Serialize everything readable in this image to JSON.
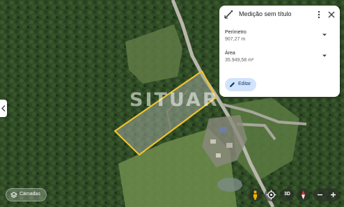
{
  "map": {
    "type": "satellite",
    "watermark": "SITUAR",
    "measured_area_color": "#f2c230"
  },
  "measurement_panel": {
    "title": "Medição sem título",
    "perimeter_label": "Perímetro",
    "perimeter_value": "907,27 m",
    "area_label": "Área",
    "area_value": "35.949,58 m²",
    "edit_label": "Editar"
  },
  "controls": {
    "layers_label": "Camadas",
    "btn_3d_label": "3D",
    "icons": [
      "pegman-icon",
      "recenter-icon",
      "compass-icon",
      "zoom-out-icon",
      "zoom-in-icon",
      "chevron-left-icon"
    ]
  },
  "colors": {
    "panel_bg": "#ffffff",
    "edit_button_bg": "#d2e3fc",
    "compass_red": "#e53935"
  }
}
